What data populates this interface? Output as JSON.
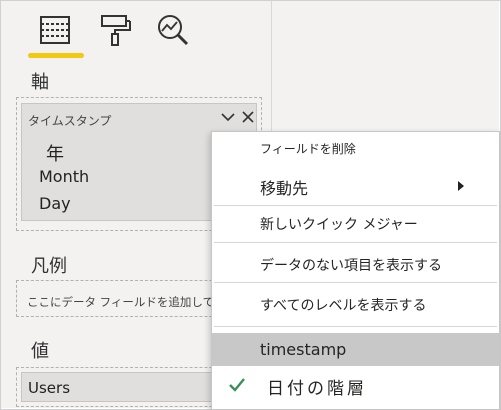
{
  "panes": {
    "fields_well_title": "軸",
    "legend_title": "凡例",
    "values_title": "値"
  },
  "icons": {
    "fields_tab": "fields-icon",
    "format_tab": "paint-roller-icon",
    "analytics_tab": "analytics-magnifier-icon",
    "accent_color": "#f2c811"
  },
  "axis_well": {
    "field_name": "タイムスタンプ",
    "hierarchy": [
      "年",
      "Month",
      "Day"
    ]
  },
  "legend_well": {
    "placeholder": "ここにデータ フィールドを追加してください"
  },
  "values_well": {
    "field_name": "Users"
  },
  "context_menu": {
    "remove_field": "フィールドを削除",
    "move_to": "移動先",
    "new_quick_measure": "新しいクイック メジャー",
    "show_items_no_data": "データのない項目を表示する",
    "show_all_levels": "すべてのレベルを表示する",
    "timestamp": "timestamp",
    "date_hierarchy": "日付の階層",
    "check_color": "#3a8f5a"
  }
}
